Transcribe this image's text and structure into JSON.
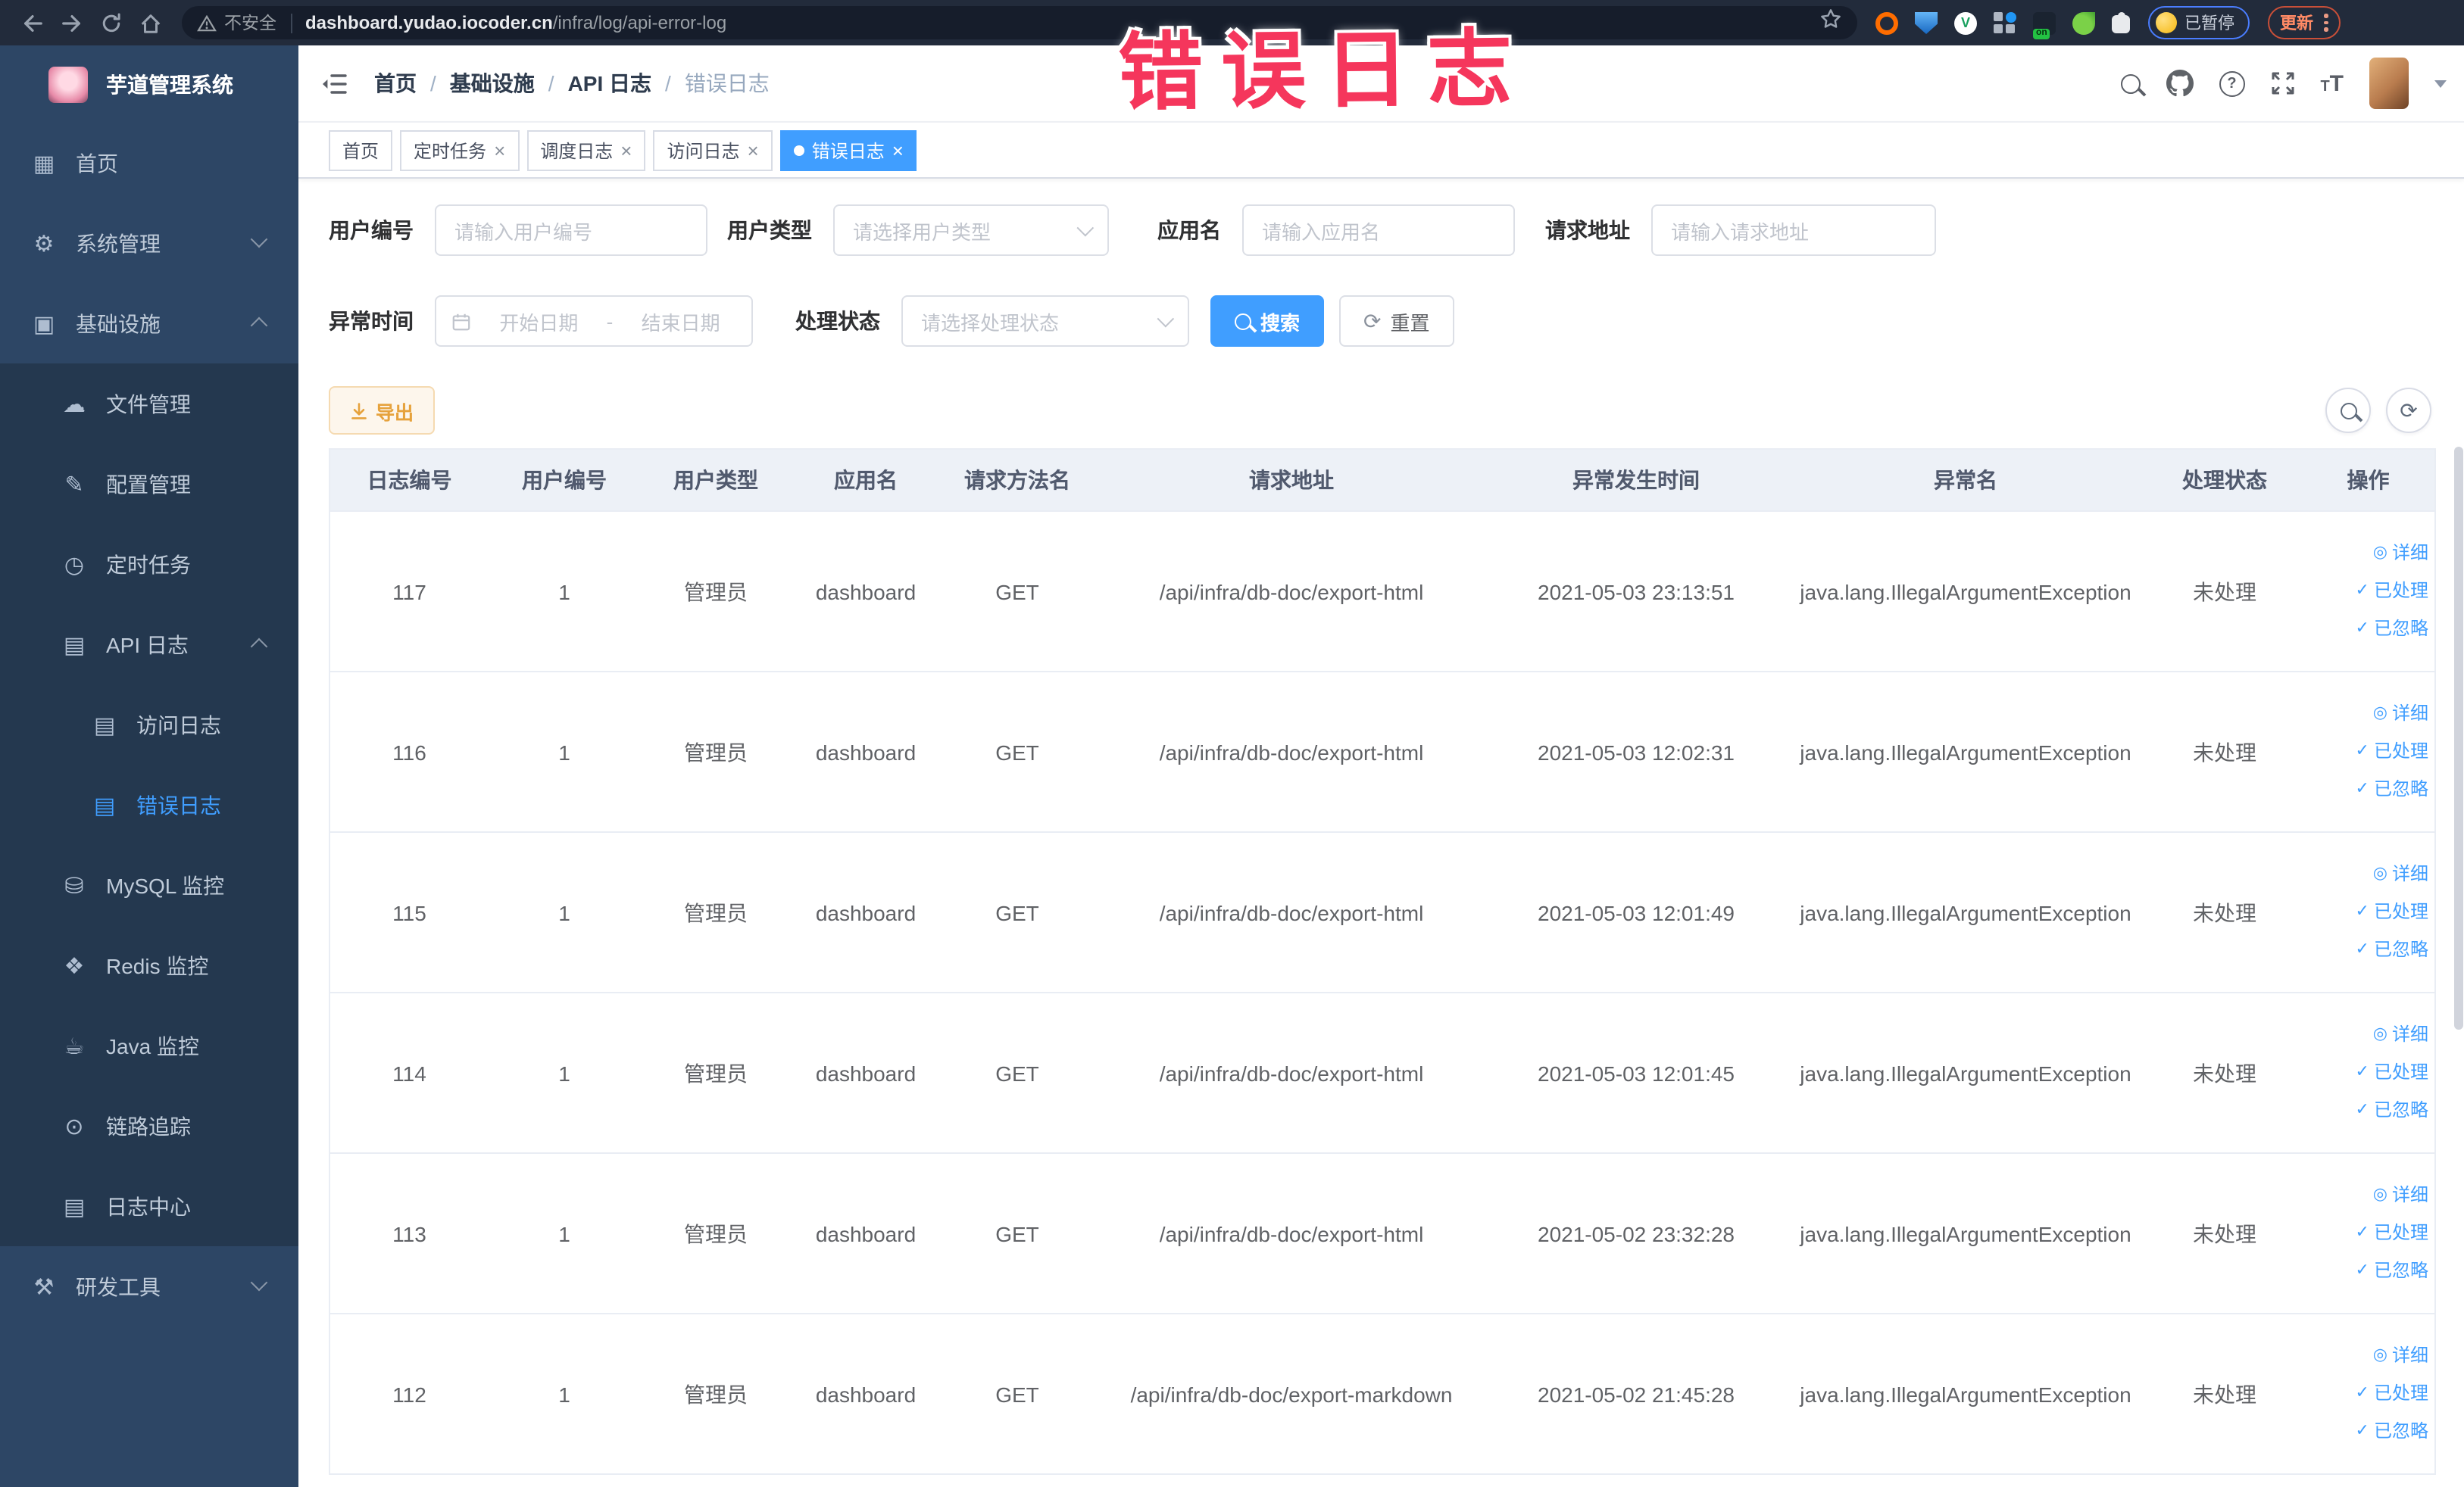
{
  "annotation": {
    "text": "错误日志"
  },
  "browser": {
    "security_label": "不安全",
    "url_host": "dashboard.yudao.iocoder.cn",
    "url_path": "/infra/log/api-error-log",
    "ext_on_badge": "on",
    "paused_label": "已暂停",
    "update_label": "更新"
  },
  "sidebar": {
    "title": "芋道管理系统",
    "items": [
      {
        "label": "首页",
        "glyph": "▦",
        "level": 1
      },
      {
        "label": "系统管理",
        "glyph": "⚙",
        "level": 1,
        "arrow": "down"
      },
      {
        "label": "基础设施",
        "glyph": "▣",
        "level": 1,
        "arrow": "up"
      },
      {
        "label": "文件管理",
        "glyph": "☁",
        "level": 2
      },
      {
        "label": "配置管理",
        "glyph": "✎",
        "level": 2
      },
      {
        "label": "定时任务",
        "glyph": "◷",
        "level": 2
      },
      {
        "label": "API 日志",
        "glyph": "▤",
        "level": 2,
        "arrow": "up"
      },
      {
        "label": "访问日志",
        "glyph": "▤",
        "level": 3
      },
      {
        "label": "错误日志",
        "glyph": "▤",
        "level": 3,
        "active": true
      },
      {
        "label": "MySQL 监控",
        "glyph": "⛁",
        "level": 2
      },
      {
        "label": "Redis 监控",
        "glyph": "❖",
        "level": 2
      },
      {
        "label": "Java 监控",
        "glyph": "☕",
        "level": 2
      },
      {
        "label": "链路追踪",
        "glyph": "⊙",
        "level": 2
      },
      {
        "label": "日志中心",
        "glyph": "▤",
        "level": 2
      },
      {
        "label": "研发工具",
        "glyph": "⚒",
        "level": 1,
        "arrow": "down"
      }
    ]
  },
  "header": {
    "breadcrumb": [
      "首页",
      "基础设施",
      "API 日志",
      "错误日志"
    ],
    "separator": "/",
    "help_glyph": "?",
    "tsize_small": "T",
    "tsize_large": "T"
  },
  "tags": {
    "close_glyph": "×",
    "items": [
      {
        "label": "首页",
        "closable": false,
        "active": false
      },
      {
        "label": "定时任务",
        "closable": true,
        "active": false
      },
      {
        "label": "调度日志",
        "closable": true,
        "active": false
      },
      {
        "label": "访问日志",
        "closable": true,
        "active": false
      },
      {
        "label": "错误日志",
        "closable": true,
        "active": true
      }
    ]
  },
  "filters": {
    "user_id": {
      "label": "用户编号",
      "placeholder": "请输入用户编号"
    },
    "user_type": {
      "label": "用户类型",
      "placeholder": "请选择用户类型"
    },
    "app_name": {
      "label": "应用名",
      "placeholder": "请输入应用名"
    },
    "request_url": {
      "label": "请求地址",
      "placeholder": "请输入请求地址"
    },
    "exception_time": {
      "label": "异常时间",
      "start_placeholder": "开始日期",
      "range_separator": "-",
      "end_placeholder": "结束日期"
    },
    "process_status": {
      "label": "处理状态",
      "placeholder": "请选择处理状态"
    },
    "search_label": "搜索",
    "reset_label": "重置",
    "reset_glyph": "⟳"
  },
  "toolbar": {
    "export_label": "导出",
    "refresh_glyph": "⟳"
  },
  "table": {
    "columns": [
      "日志编号",
      "用户编号",
      "用户类型",
      "应用名",
      "请求方法名",
      "请求地址",
      "异常发生时间",
      "异常名",
      "处理状态",
      "操作"
    ],
    "actions": [
      {
        "label": "详细",
        "glyph": "◎"
      },
      {
        "label": "已处理",
        "glyph": "✓"
      },
      {
        "label": "已忽略",
        "glyph": "✓"
      }
    ],
    "rows": [
      {
        "log_id": "117",
        "user_id": "1",
        "user_type": "管理员",
        "app_name": "dashboard",
        "method": "GET",
        "url": "/api/infra/db-doc/export-html",
        "time": "2021-05-03 23:13:51",
        "exception": "java.lang.IllegalArgumentException",
        "status": "未处理"
      },
      {
        "log_id": "116",
        "user_id": "1",
        "user_type": "管理员",
        "app_name": "dashboard",
        "method": "GET",
        "url": "/api/infra/db-doc/export-html",
        "time": "2021-05-03 12:02:31",
        "exception": "java.lang.IllegalArgumentException",
        "status": "未处理"
      },
      {
        "log_id": "115",
        "user_id": "1",
        "user_type": "管理员",
        "app_name": "dashboard",
        "method": "GET",
        "url": "/api/infra/db-doc/export-html",
        "time": "2021-05-03 12:01:49",
        "exception": "java.lang.IllegalArgumentException",
        "status": "未处理"
      },
      {
        "log_id": "114",
        "user_id": "1",
        "user_type": "管理员",
        "app_name": "dashboard",
        "method": "GET",
        "url": "/api/infra/db-doc/export-html",
        "time": "2021-05-03 12:01:45",
        "exception": "java.lang.IllegalArgumentException",
        "status": "未处理"
      },
      {
        "log_id": "113",
        "user_id": "1",
        "user_type": "管理员",
        "app_name": "dashboard",
        "method": "GET",
        "url": "/api/infra/db-doc/export-html",
        "time": "2021-05-02 23:32:28",
        "exception": "java.lang.IllegalArgumentException",
        "status": "未处理"
      },
      {
        "log_id": "112",
        "user_id": "1",
        "user_type": "管理员",
        "app_name": "dashboard",
        "method": "GET",
        "url": "/api/infra/db-doc/export-markdown",
        "time": "2021-05-02 21:45:28",
        "exception": "java.lang.IllegalArgumentException",
        "status": "未处理"
      }
    ]
  },
  "colors": {
    "primary": "#409EFF",
    "warning_text": "#E6A23C",
    "warning_bg": "#FDF6EC",
    "warning_border": "#F5DAB1",
    "sidebar_bg": "#2D4665",
    "submenu_bg": "#24384F",
    "annotation": "#F5365C"
  }
}
